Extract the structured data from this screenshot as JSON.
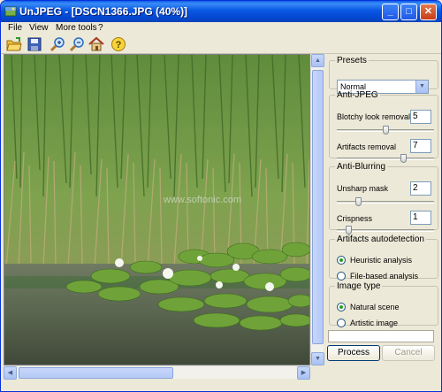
{
  "window": {
    "title": "UnJPEG - [DSCN1366.JPG (40%)]"
  },
  "titlebar_buttons": {
    "minimize": "_",
    "maximize": "□",
    "close": "✕"
  },
  "menu": [
    "File",
    "View",
    "More tools",
    "?"
  ],
  "toolbar": [
    "open-icon",
    "save-icon",
    "zoom-in-icon",
    "zoom-out-icon",
    "home-icon",
    "help-icon"
  ],
  "image_watermark": "www.softonic.com",
  "panel": {
    "presets": {
      "legend": "Presets",
      "selected": "Normal"
    },
    "anti_jpeg": {
      "legend": "Anti-JPEG",
      "blotchy": {
        "label": "Blotchy look removal",
        "value": "5",
        "level": 0.5
      },
      "artifacts": {
        "label": "Artifacts removal",
        "value": "7",
        "level": 0.7
      }
    },
    "anti_blurring": {
      "legend": "Anti-Blurring",
      "unsharp": {
        "label": "Unsharp mask",
        "value": "2",
        "level": 0.2
      },
      "crispness": {
        "label": "Crispness",
        "value": "1",
        "level": 0.1
      }
    },
    "autodetect": {
      "legend": "Artifacts autodetection",
      "options": [
        {
          "label": "Heuristic analysis",
          "checked": true
        },
        {
          "label": "File-based analysis",
          "checked": false
        }
      ]
    },
    "image_type": {
      "legend": "Image type",
      "options": [
        {
          "label": "Natural scene",
          "checked": true
        },
        {
          "label": "Artistic image",
          "checked": false
        }
      ]
    }
  },
  "buttons": {
    "process": "Process",
    "cancel": "Cancel"
  }
}
